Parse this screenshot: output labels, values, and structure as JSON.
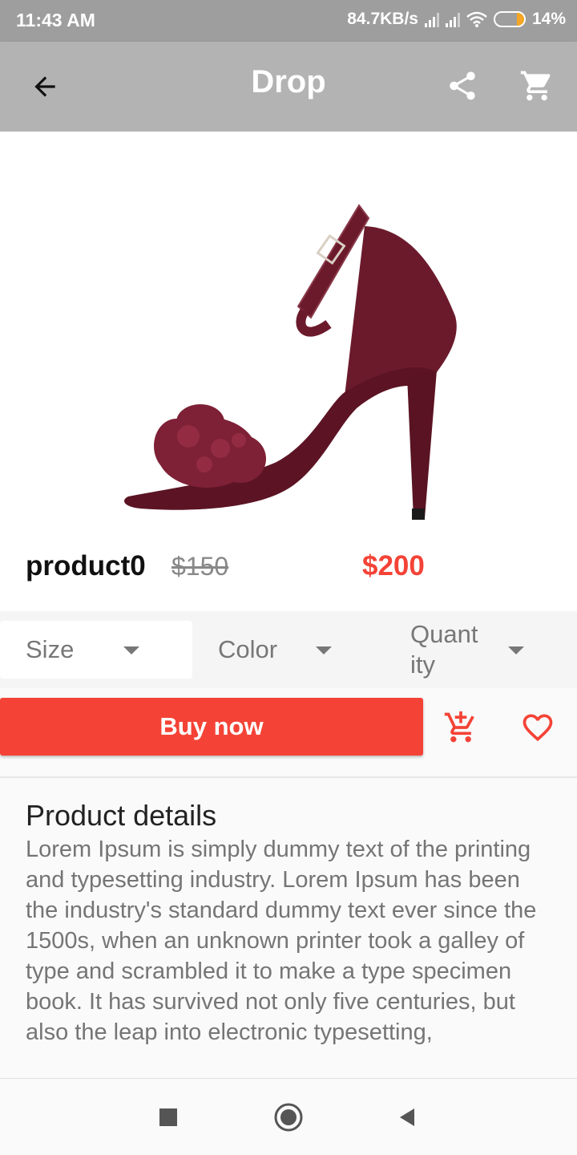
{
  "status_bar": {
    "time": "11:43 AM",
    "network_speed": "84.7KB/s",
    "battery": "14%",
    "battery_level": 0.14,
    "icons": [
      "signal-icon",
      "signal-icon",
      "wifi-icon",
      "battery-icon"
    ]
  },
  "app_bar": {
    "title": "Drop",
    "back_icon": "back-arrow-icon",
    "share_icon": "share-icon",
    "cart_icon": "cart-icon"
  },
  "product": {
    "image": "burgundy-stiletto-heel-sandal",
    "name": "product0",
    "old_price": "$150",
    "price": "$200"
  },
  "options": {
    "size": "Size",
    "color": "Color",
    "quantity_line1": "Quant",
    "quantity_line2": "ity"
  },
  "actions": {
    "buy_now": "Buy now",
    "add_to_cart_icon": "add-to-cart-icon",
    "favorite_icon": "heart-icon"
  },
  "details": {
    "title": "Product details",
    "body": "Lorem Ipsum is simply dummy text of the printing and typesetting industry. Lorem Ipsum has been the industry's standard dummy text ever since the 1500s, when an unknown printer took a galley of type and scrambled it to make a type specimen book. It has survived not only five centuries, but also the leap into electronic typesetting,"
  },
  "colors": {
    "accent": "#f44336",
    "app_bar": "#b3b3b3",
    "status_bar": "#9e9e9e",
    "product": "#6b1a2c"
  },
  "nav": {
    "recents_icon": "square-icon",
    "home_icon": "home-circle-icon",
    "back_icon": "triangle-back-icon"
  }
}
